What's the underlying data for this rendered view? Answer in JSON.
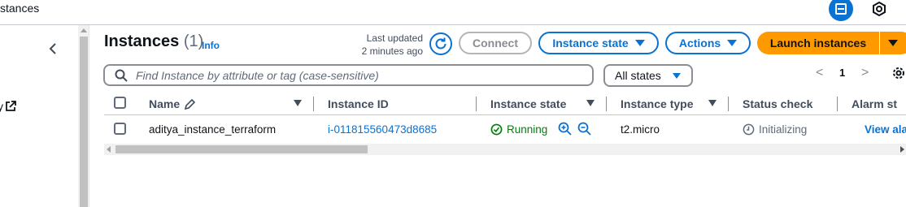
{
  "breadcrumb": {
    "current": "stances"
  },
  "topbar": {
    "panel_icon": "split-panel-icon",
    "settings_icon": "hexagon-gear-icon"
  },
  "nav": {
    "collapse_icon": "chevron-left-icon",
    "external_icon": "external-link-icon",
    "external_text": "y"
  },
  "header": {
    "title": "Instances",
    "count": "(1)",
    "info": "Info",
    "last_updated_label": "Last updated",
    "last_updated_value": "2 minutes ago"
  },
  "buttons": {
    "connect": "Connect",
    "instance_state": "Instance state",
    "actions": "Actions",
    "launch": "Launch instances"
  },
  "search": {
    "placeholder": "Find Instance by attribute or tag (case-sensitive)"
  },
  "filter": {
    "selected": "All states"
  },
  "pagination": {
    "prev": "<",
    "page": "1",
    "next": ">"
  },
  "table": {
    "columns": [
      "Name",
      "Instance ID",
      "Instance state",
      "Instance type",
      "Status check",
      "Alarm st"
    ],
    "rows": [
      {
        "name": "aditya_instance_terraform",
        "instance_id": "i-011815560473d8685",
        "state": "Running",
        "type": "t2.micro",
        "status_check": "Initializing",
        "alarm": "View ala"
      }
    ]
  },
  "colors": {
    "accent": "#0972d3",
    "launch": "#ff9900",
    "running": "#037f0c",
    "muted": "#5f6b7a"
  }
}
